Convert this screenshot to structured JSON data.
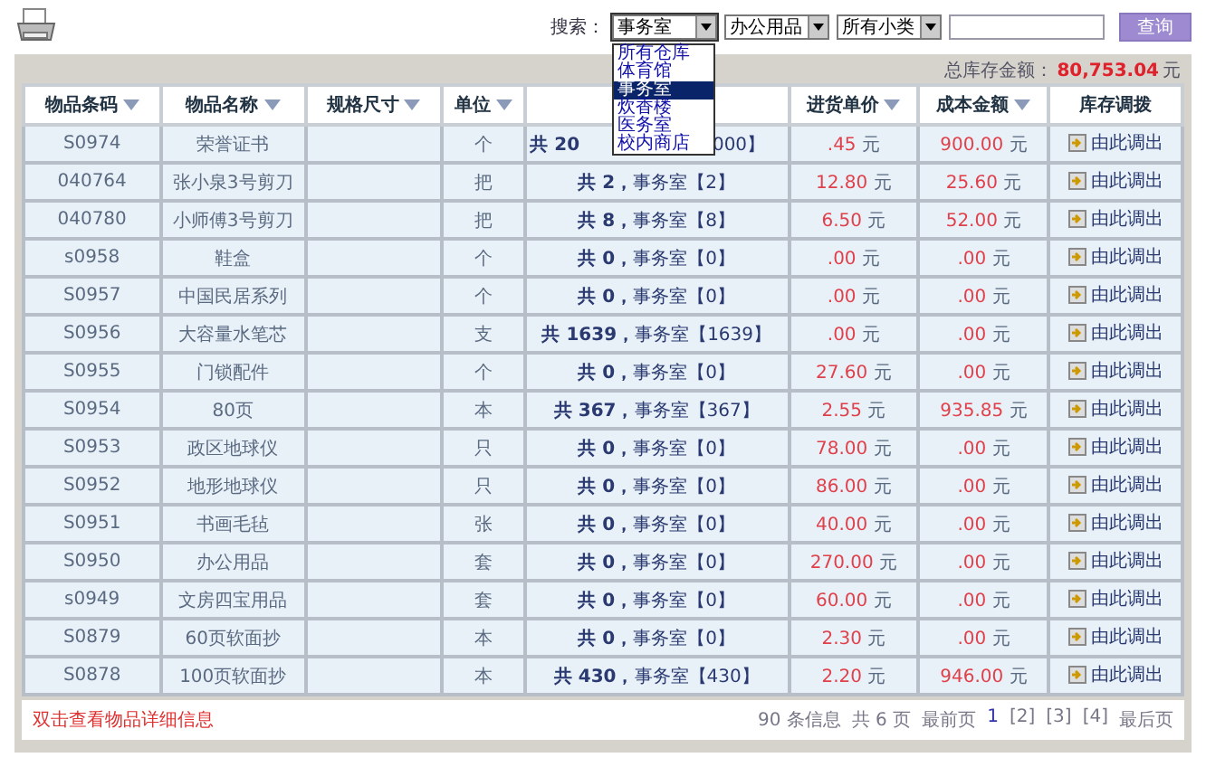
{
  "search": {
    "label": "搜索：",
    "selects": [
      {
        "value": "事务室",
        "open": true
      },
      {
        "value": "办公用品",
        "open": false
      },
      {
        "value": "所有小类",
        "open": false
      }
    ],
    "button": "查询"
  },
  "dropdown": [
    {
      "label": "所有仓库",
      "selected": false
    },
    {
      "label": "体育馆",
      "selected": false
    },
    {
      "label": "事务室",
      "selected": true
    },
    {
      "label": "炊香楼",
      "selected": false
    },
    {
      "label": "医务室",
      "selected": false
    },
    {
      "label": "校内商店",
      "selected": false
    }
  ],
  "total": {
    "label": "总库存金额：",
    "value": "80,753.04",
    "unit": "元"
  },
  "columns": [
    {
      "label": "物品条码",
      "sortable": true
    },
    {
      "label": "物品名称",
      "sortable": true
    },
    {
      "label": "规格尺寸",
      "sortable": true
    },
    {
      "label": "单位",
      "sortable": true
    },
    {
      "sortable": false
    },
    {
      "label": "进货单价",
      "sortable": true
    },
    {
      "label": "成本金额",
      "sortable": true
    },
    {
      "label": "库存调拨",
      "sortable": false
    }
  ],
  "rows": [
    {
      "code": "S0974",
      "name": "荣誉证书",
      "unit": "个",
      "stock_total": "共 20",
      "stock_place": "000】",
      "obscured": true,
      "price": ".45",
      "price_unit": "元",
      "cost": "900.00",
      "cost_unit": "元",
      "action": "由此调出"
    },
    {
      "code": "040764",
      "name": "张小泉3号剪刀",
      "unit": "把",
      "stock_total": "共 2，",
      "stock_place": "事务室【2】",
      "price": "12.80",
      "price_unit": "元",
      "cost": "25.60",
      "cost_unit": "元",
      "action": "由此调出"
    },
    {
      "code": "040780",
      "name": "小师傅3号剪刀",
      "unit": "把",
      "stock_total": "共 8，",
      "stock_place": "事务室【8】",
      "price": "6.50",
      "price_unit": "元",
      "cost": "52.00",
      "cost_unit": "元",
      "action": "由此调出"
    },
    {
      "code": "s0958",
      "name": "鞋盒",
      "unit": "个",
      "stock_total": "共 0，",
      "stock_place": "事务室【0】",
      "price": ".00",
      "price_unit": "元",
      "cost": ".00",
      "cost_unit": "元",
      "action": "由此调出"
    },
    {
      "code": "S0957",
      "name": "中国民居系列",
      "unit": "个",
      "stock_total": "共 0，",
      "stock_place": "事务室【0】",
      "price": ".00",
      "price_unit": "元",
      "cost": ".00",
      "cost_unit": "元",
      "action": "由此调出"
    },
    {
      "code": "S0956",
      "name": "大容量水笔芯",
      "unit": "支",
      "stock_total": "共 1639，",
      "stock_place": "事务室【1639】",
      "price": ".00",
      "price_unit": "元",
      "cost": ".00",
      "cost_unit": "元",
      "action": "由此调出"
    },
    {
      "code": "S0955",
      "name": "门锁配件",
      "unit": "个",
      "stock_total": "共 0，",
      "stock_place": "事务室【0】",
      "price": "27.60",
      "price_unit": "元",
      "cost": ".00",
      "cost_unit": "元",
      "action": "由此调出"
    },
    {
      "code": "S0954",
      "name": "80页",
      "unit": "本",
      "stock_total": "共 367，",
      "stock_place": "事务室【367】",
      "price": "2.55",
      "price_unit": "元",
      "cost": "935.85",
      "cost_unit": "元",
      "action": "由此调出"
    },
    {
      "code": "S0953",
      "name": "政区地球仪",
      "unit": "只",
      "stock_total": "共 0，",
      "stock_place": "事务室【0】",
      "price": "78.00",
      "price_unit": "元",
      "cost": ".00",
      "cost_unit": "元",
      "action": "由此调出"
    },
    {
      "code": "S0952",
      "name": "地形地球仪",
      "unit": "只",
      "stock_total": "共 0，",
      "stock_place": "事务室【0】",
      "price": "86.00",
      "price_unit": "元",
      "cost": ".00",
      "cost_unit": "元",
      "action": "由此调出"
    },
    {
      "code": "S0951",
      "name": "书画毛毡",
      "unit": "张",
      "stock_total": "共 0，",
      "stock_place": "事务室【0】",
      "price": "40.00",
      "price_unit": "元",
      "cost": ".00",
      "cost_unit": "元",
      "action": "由此调出"
    },
    {
      "code": "S0950",
      "name": "办公用品",
      "unit": "套",
      "stock_total": "共 0，",
      "stock_place": "事务室【0】",
      "price": "270.00",
      "price_unit": "元",
      "cost": ".00",
      "cost_unit": "元",
      "action": "由此调出"
    },
    {
      "code": "s0949",
      "name": "文房四宝用品",
      "unit": "套",
      "stock_total": "共 0，",
      "stock_place": "事务室【0】",
      "price": "60.00",
      "price_unit": "元",
      "cost": ".00",
      "cost_unit": "元",
      "action": "由此调出"
    },
    {
      "code": "S0879",
      "name": "60页软面抄",
      "unit": "本",
      "stock_total": "共 0，",
      "stock_place": "事务室【0】",
      "price": "2.30",
      "price_unit": "元",
      "cost": ".00",
      "cost_unit": "元",
      "action": "由此调出"
    },
    {
      "code": "S0878",
      "name": "100页软面抄",
      "unit": "本",
      "stock_total": "共 430，",
      "stock_place": "事务室【430】",
      "price": "2.20",
      "price_unit": "元",
      "cost": "946.00",
      "cost_unit": "元",
      "action": "由此调出"
    }
  ],
  "hint": "双击查看物品详细信息",
  "pager": {
    "count": "90 条信息",
    "pages": "共 6 页",
    "first": "最前页",
    "links": [
      {
        "label": "1",
        "selected": true
      },
      {
        "label": "[2]",
        "selected": false
      },
      {
        "label": "[3]",
        "selected": false
      },
      {
        "label": "[4]",
        "selected": false
      }
    ],
    "last": "最后页"
  }
}
